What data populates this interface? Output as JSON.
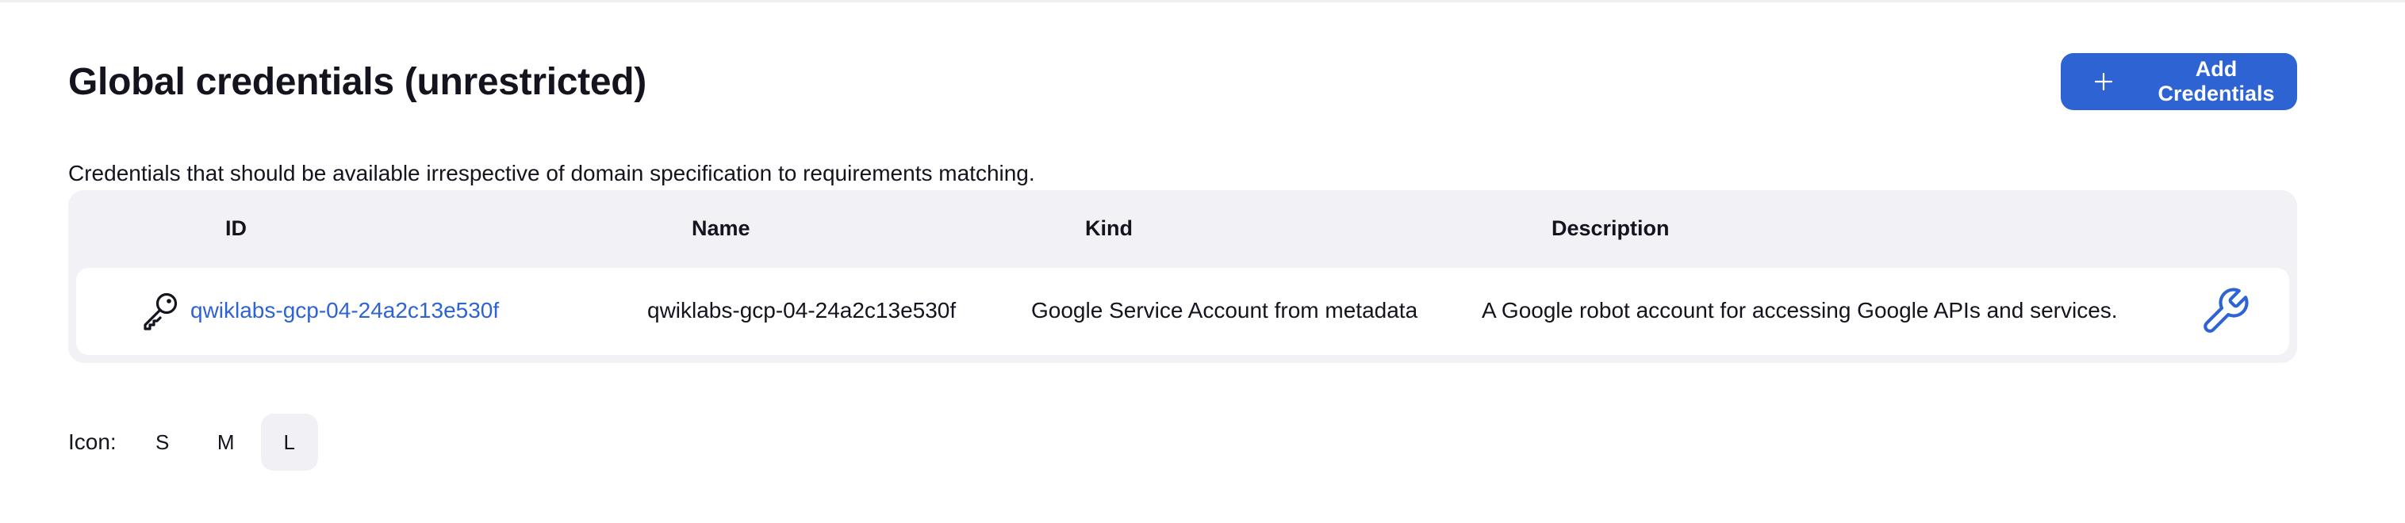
{
  "page": {
    "title": "Global credentials (unrestricted)",
    "description": "Credentials that should be available irrespective of domain specification to requirements matching."
  },
  "toolbar": {
    "add_label": "Add Credentials",
    "add_icon": "plus-icon"
  },
  "table": {
    "headers": {
      "id": "ID",
      "name": "Name",
      "kind": "Kind",
      "description": "Description"
    },
    "rows": [
      {
        "icon": "key-icon",
        "id": "qwiklabs-gcp-04-24a2c13e530f",
        "name": "qwiklabs-gcp-04-24a2c13e530f",
        "kind": "Google Service Account from metadata",
        "description": "A Google robot account for accessing Google APIs and services.",
        "action_icon": "wrench-icon"
      }
    ]
  },
  "icon_size": {
    "label": "Icon:",
    "options": [
      "S",
      "M",
      "L"
    ],
    "selected": "L"
  },
  "colors": {
    "accent": "#2e63d3",
    "table_bg": "#f2f2f6",
    "row_bg": "#ffffff",
    "text": "#14141f"
  }
}
